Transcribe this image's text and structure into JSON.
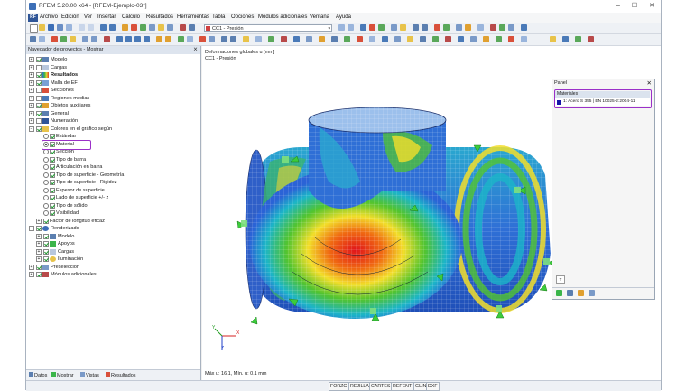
{
  "window": {
    "title": "RFEM 5.20.00 x64 - [RFEM-Ejemplo-03*]",
    "min_glyph": "–",
    "max_glyph": "☐",
    "close_glyph": "✕"
  },
  "menu": {
    "logo": "RF",
    "items": [
      "Archivo",
      "Edición",
      "Ver",
      "Insertar",
      "Cálculo",
      "Resultados",
      "Herramientas",
      "Tabla",
      "Opciones",
      "Módulos adicionales",
      "Ventana",
      "Ayuda"
    ]
  },
  "toolbar": {
    "load_case": "CC1 - Presión",
    "combo_arrow": "▾"
  },
  "navigator": {
    "title": "Navegador de proyectos - Mostrar",
    "close_glyph": "⨯",
    "items": [
      {
        "label": "Modelo",
        "expander": "+"
      },
      {
        "label": "Cargas",
        "expander": "+"
      },
      {
        "label": "Resultados",
        "expander": "+"
      },
      {
        "label": "Malla de EF",
        "expander": "+"
      },
      {
        "label": "Secciones",
        "expander": "+"
      },
      {
        "label": "Regiones medias",
        "expander": "+"
      },
      {
        "label": "Objetos auxiliares",
        "expander": "+"
      },
      {
        "label": "General",
        "expander": "+"
      },
      {
        "label": "Numeración",
        "expander": "+"
      },
      {
        "label": "Colores en el gráfico según",
        "expander": "−"
      },
      {
        "label": "Estándar"
      },
      {
        "label": "Material"
      },
      {
        "label": "Sección"
      },
      {
        "label": "Tipo de barra"
      },
      {
        "label": "Articulación en barra"
      },
      {
        "label": "Tipo de superficie - Geometría"
      },
      {
        "label": "Tipo de superficie - Rigidez"
      },
      {
        "label": "Espesor de superficie"
      },
      {
        "label": "Lado de superficie +/- z"
      },
      {
        "label": "Tipo de sólido"
      },
      {
        "label": "Visibilidad"
      },
      {
        "label": "Factor de longitud eficaz",
        "expander": "+"
      },
      {
        "label": "Renderizado",
        "expander": "−"
      },
      {
        "label": "Modelo",
        "expander": "+"
      },
      {
        "label": "Apoyos",
        "expander": "+"
      },
      {
        "label": "Cargas",
        "expander": "+"
      },
      {
        "label": "Iluminación",
        "expander": "+"
      },
      {
        "label": "Preselección",
        "expander": "+"
      },
      {
        "label": "Módulos adicionales",
        "expander": "+"
      }
    ],
    "tabs": [
      "Datos",
      "Mostrar",
      "Vistas",
      "Resultados"
    ]
  },
  "viewport": {
    "line1": "Deformaciones globales u [mm]",
    "line2": "CC1 - Presión",
    "status": "Máx u: 16.1, Mín. u: 0.1 mm",
    "axis_x": "X",
    "axis_y": "Y",
    "axis_z": "Z"
  },
  "panel": {
    "title": "Panel",
    "close_glyph": "✕",
    "header": "Materiales",
    "material": "1: Acero S 355 | EN 10025-2:2004-11",
    "material_color": "#1616a8",
    "button_glyph": "T"
  },
  "statusbar": {
    "keys": [
      "FORZC",
      "REJILLA",
      "CARTES",
      "REFENT",
      "GLIN",
      "DXF"
    ]
  }
}
